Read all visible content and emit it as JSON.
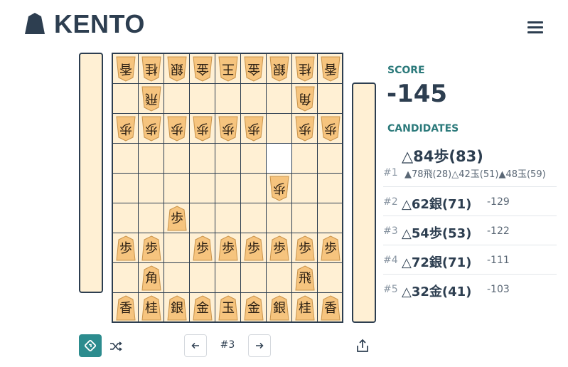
{
  "app": {
    "title": "KENTO"
  },
  "icons": {
    "logo": "shogi-piece-icon",
    "menu": "hamburger-menu-icon",
    "flip": "flip-board-icon",
    "shuffle": "shuffle-icon",
    "prev": "arrow-left-icon",
    "next": "arrow-right-icon",
    "share": "share-icon"
  },
  "colors": {
    "accent": "#2c8c8e",
    "board": "#fff0d4",
    "piece": "#f6c47e",
    "ink": "#2d3e50",
    "label": "#2c7a7b"
  },
  "board": {
    "highlight": [
      {
        "row": 3,
        "col": 6
      }
    ],
    "pieces": [
      {
        "row": 0,
        "col": 0,
        "ch": "香",
        "side": "gote"
      },
      {
        "row": 0,
        "col": 1,
        "ch": "桂",
        "side": "gote"
      },
      {
        "row": 0,
        "col": 2,
        "ch": "銀",
        "side": "gote"
      },
      {
        "row": 0,
        "col": 3,
        "ch": "金",
        "side": "gote"
      },
      {
        "row": 0,
        "col": 4,
        "ch": "王",
        "side": "gote"
      },
      {
        "row": 0,
        "col": 5,
        "ch": "金",
        "side": "gote"
      },
      {
        "row": 0,
        "col": 6,
        "ch": "銀",
        "side": "gote"
      },
      {
        "row": 0,
        "col": 7,
        "ch": "桂",
        "side": "gote"
      },
      {
        "row": 0,
        "col": 8,
        "ch": "香",
        "side": "gote"
      },
      {
        "row": 1,
        "col": 1,
        "ch": "飛",
        "side": "gote"
      },
      {
        "row": 1,
        "col": 7,
        "ch": "角",
        "side": "gote"
      },
      {
        "row": 2,
        "col": 0,
        "ch": "歩",
        "side": "gote"
      },
      {
        "row": 2,
        "col": 1,
        "ch": "歩",
        "side": "gote"
      },
      {
        "row": 2,
        "col": 2,
        "ch": "歩",
        "side": "gote"
      },
      {
        "row": 2,
        "col": 3,
        "ch": "歩",
        "side": "gote"
      },
      {
        "row": 2,
        "col": 4,
        "ch": "歩",
        "side": "gote"
      },
      {
        "row": 2,
        "col": 5,
        "ch": "歩",
        "side": "gote"
      },
      {
        "row": 2,
        "col": 7,
        "ch": "歩",
        "side": "gote"
      },
      {
        "row": 2,
        "col": 8,
        "ch": "歩",
        "side": "gote"
      },
      {
        "row": 4,
        "col": 6,
        "ch": "歩",
        "side": "gote"
      },
      {
        "row": 5,
        "col": 2,
        "ch": "歩",
        "side": "sente"
      },
      {
        "row": 6,
        "col": 0,
        "ch": "歩",
        "side": "sente"
      },
      {
        "row": 6,
        "col": 1,
        "ch": "歩",
        "side": "sente"
      },
      {
        "row": 6,
        "col": 3,
        "ch": "歩",
        "side": "sente"
      },
      {
        "row": 6,
        "col": 4,
        "ch": "歩",
        "side": "sente"
      },
      {
        "row": 6,
        "col": 5,
        "ch": "歩",
        "side": "sente"
      },
      {
        "row": 6,
        "col": 6,
        "ch": "歩",
        "side": "sente"
      },
      {
        "row": 6,
        "col": 7,
        "ch": "歩",
        "side": "sente"
      },
      {
        "row": 6,
        "col": 8,
        "ch": "歩",
        "side": "sente"
      },
      {
        "row": 7,
        "col": 1,
        "ch": "角",
        "side": "sente"
      },
      {
        "row": 7,
        "col": 7,
        "ch": "飛",
        "side": "sente"
      },
      {
        "row": 8,
        "col": 0,
        "ch": "香",
        "side": "sente"
      },
      {
        "row": 8,
        "col": 1,
        "ch": "桂",
        "side": "sente"
      },
      {
        "row": 8,
        "col": 2,
        "ch": "銀",
        "side": "sente"
      },
      {
        "row": 8,
        "col": 3,
        "ch": "金",
        "side": "sente"
      },
      {
        "row": 8,
        "col": 4,
        "ch": "玉",
        "side": "sente"
      },
      {
        "row": 8,
        "col": 5,
        "ch": "金",
        "side": "sente"
      },
      {
        "row": 8,
        "col": 6,
        "ch": "銀",
        "side": "sente"
      },
      {
        "row": 8,
        "col": 7,
        "ch": "桂",
        "side": "sente"
      },
      {
        "row": 8,
        "col": 8,
        "ch": "香",
        "side": "sente"
      }
    ]
  },
  "analysis": {
    "score_label": "SCORE",
    "score": "-145",
    "candidates_label": "CANDIDATES",
    "candidates": [
      {
        "rank": "#1",
        "move": "△84歩(83)",
        "score": "",
        "pv": "▲78飛(28)△42玉(51)▲48玉(59)"
      },
      {
        "rank": "#2",
        "move": "△62銀(71)",
        "score": "-129"
      },
      {
        "rank": "#3",
        "move": "△54歩(53)",
        "score": "-122"
      },
      {
        "rank": "#4",
        "move": "△72銀(71)",
        "score": "-111"
      },
      {
        "rank": "#5",
        "move": "△32金(41)",
        "score": "-103"
      }
    ]
  },
  "navigation": {
    "move_number": "#3"
  }
}
